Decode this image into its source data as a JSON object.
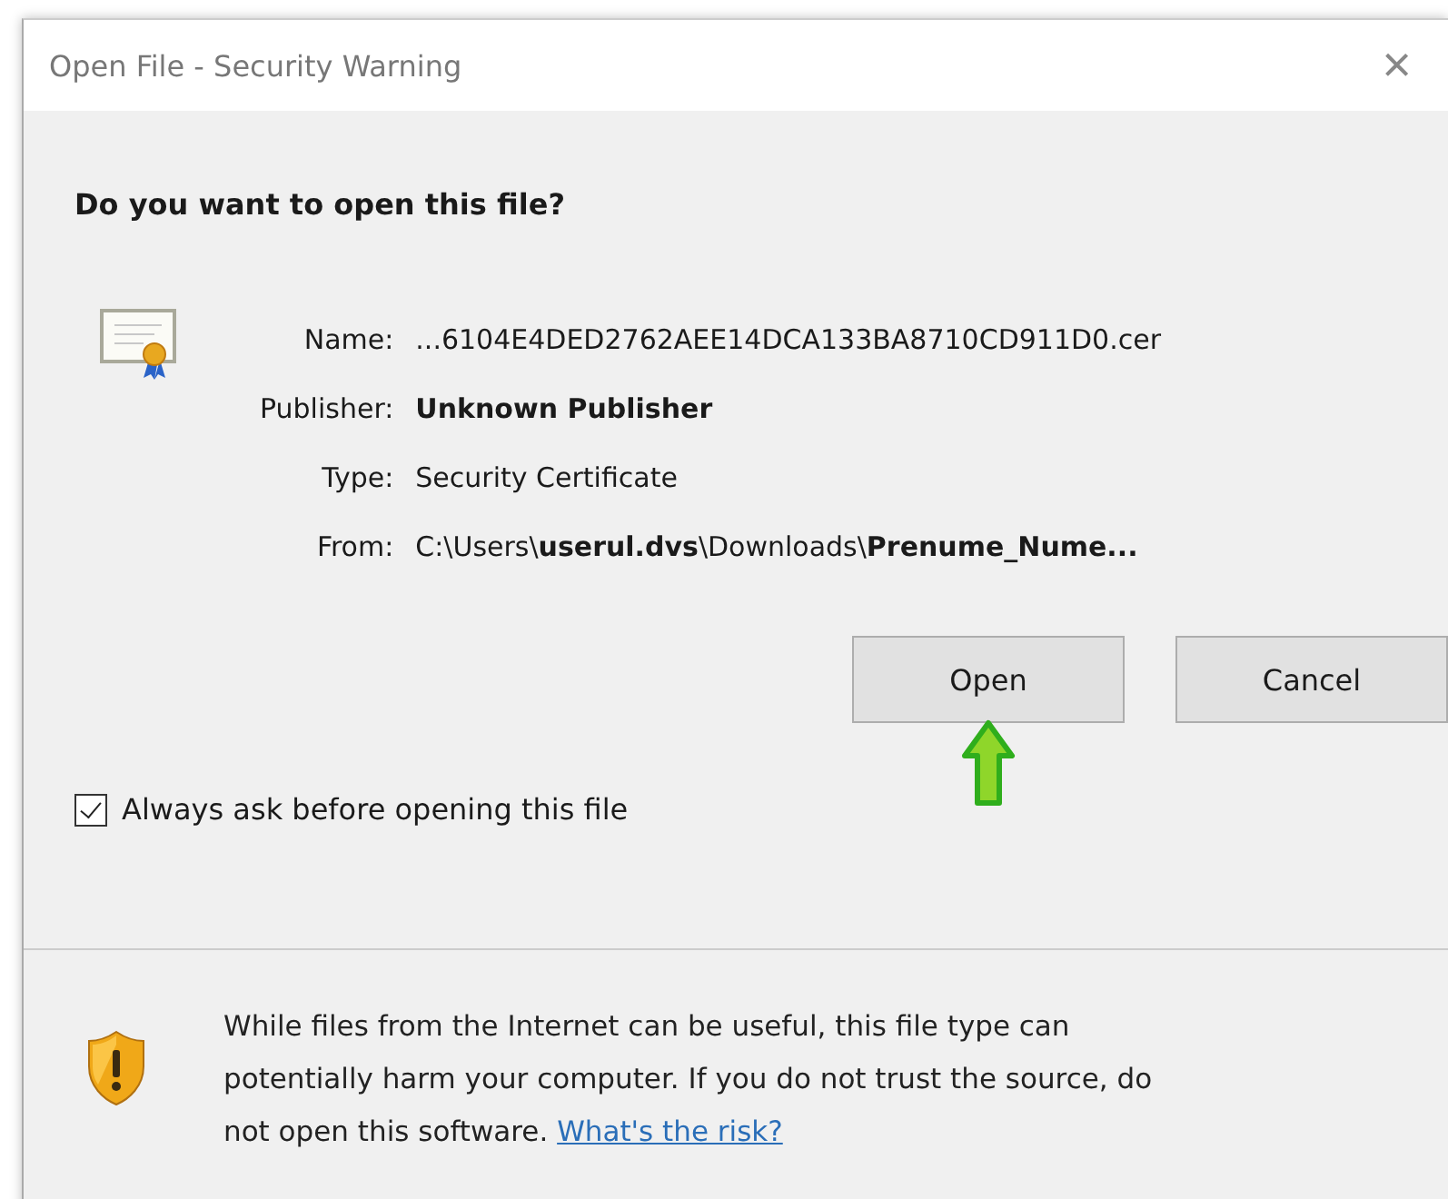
{
  "window": {
    "title": "Open File - Security Warning",
    "close": "×"
  },
  "question": "Do you want to open this file?",
  "details": [
    {
      "label": "Name:",
      "value": "...6104E4DED2762AEE14DCA133BA8710CD911D0.cer",
      "bold": false
    },
    {
      "label": "Publisher:",
      "value": "Unknown Publisher",
      "bold": true
    },
    {
      "label": "Type:",
      "value": "Security Certificate",
      "bold": false
    },
    {
      "label": "From:",
      "value": "C:\\Users\\**userul.dvs**\\Downloads\\**Prenume_Nume...**",
      "bold": false
    }
  ],
  "buttons": [
    "Open",
    "Cancel"
  ],
  "checkbox": {
    "label": "Always ask before opening this file",
    "checked": true
  },
  "warning": {
    "text": "While files from the Internet can be useful, this file type can potentially harm your computer. If you do not trust the source, do not open this software.",
    "link": "What's the risk?"
  }
}
